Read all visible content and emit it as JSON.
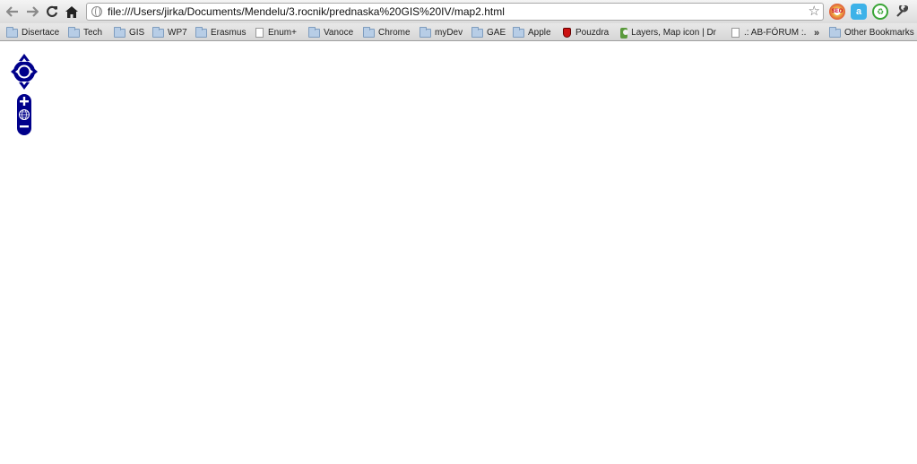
{
  "toolbar": {
    "back_icon": "arrow-left-icon",
    "forward_icon": "arrow-right-icon",
    "reload_icon": "reload-icon",
    "home_icon": "home-icon",
    "url": "file:///Users/jirka/Documents/Mendelu/3.rocnik/prednaska%20GIS%20IV/map2.html",
    "extensions": [
      {
        "name": "seo-extension-icon",
        "label": "SEO"
      },
      {
        "name": "a-extension-icon",
        "label": "a"
      },
      {
        "name": "green-extension-icon",
        "label": "♻"
      }
    ]
  },
  "bookmarks": {
    "items": [
      {
        "label": "Disertace",
        "icon": "folder-icon"
      },
      {
        "label": "Tech",
        "icon": "folder-icon"
      },
      {
        "label": "GIS",
        "icon": "folder-icon"
      },
      {
        "label": "WP7",
        "icon": "folder-icon"
      },
      {
        "label": "Erasmus",
        "icon": "folder-icon"
      },
      {
        "label": "Enum+",
        "icon": "page-icon"
      },
      {
        "label": "Vanoce",
        "icon": "folder-icon"
      },
      {
        "label": "Chrome",
        "icon": "folder-icon"
      },
      {
        "label": "myDev",
        "icon": "folder-icon"
      },
      {
        "label": "GAE",
        "icon": "folder-icon"
      },
      {
        "label": "Apple",
        "icon": "folder-icon"
      },
      {
        "label": "Pouzdra",
        "icon": "shield-icon"
      },
      {
        "label": "Layers, Map icon | Dr",
        "icon": "gis-icon"
      },
      {
        "label": ".: AB-FÓRUM :.",
        "icon": "page-icon"
      }
    ],
    "more_label": "»",
    "other_label": "Other Bookmarks"
  },
  "map": {
    "control_color": "#00008b"
  }
}
